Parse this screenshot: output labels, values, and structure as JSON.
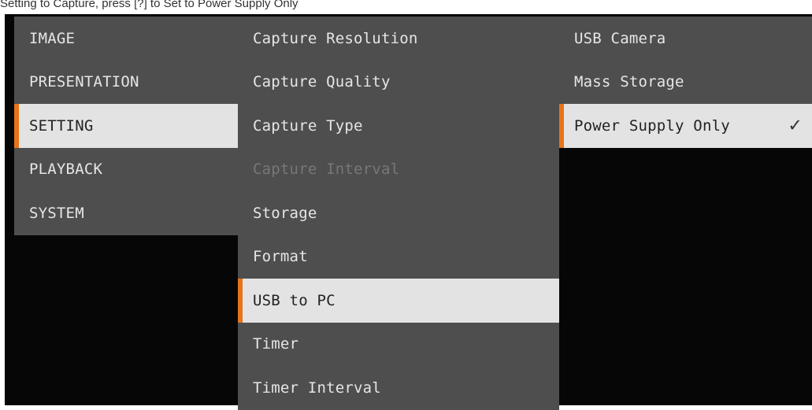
{
  "caption": "Setting to Capture, press [?] to Set to Power Supply Only",
  "main_menu": {
    "items": [
      {
        "label": "IMAGE",
        "selected": false
      },
      {
        "label": "PRESENTATION",
        "selected": false
      },
      {
        "label": "SETTING",
        "selected": true
      },
      {
        "label": "PLAYBACK",
        "selected": false
      },
      {
        "label": "SYSTEM",
        "selected": false
      }
    ]
  },
  "setting_menu": {
    "items": [
      {
        "label": "Capture Resolution",
        "selected": false,
        "enabled": true
      },
      {
        "label": "Capture Quality",
        "selected": false,
        "enabled": true
      },
      {
        "label": "Capture Type",
        "selected": false,
        "enabled": true
      },
      {
        "label": "Capture Interval",
        "selected": false,
        "enabled": false
      },
      {
        "label": "Storage",
        "selected": false,
        "enabled": true
      },
      {
        "label": "Format",
        "selected": false,
        "enabled": true
      },
      {
        "label": "USB to PC",
        "selected": true,
        "enabled": true
      },
      {
        "label": "Timer",
        "selected": false,
        "enabled": true
      },
      {
        "label": "Timer Interval",
        "selected": false,
        "enabled": true
      }
    ]
  },
  "usb_options": {
    "items": [
      {
        "label": "USB Camera",
        "selected": false,
        "checked": false
      },
      {
        "label": "Mass Storage",
        "selected": false,
        "checked": false
      },
      {
        "label": "Power Supply Only",
        "selected": true,
        "checked": true
      }
    ],
    "check_glyph": "✓"
  },
  "colors": {
    "accent": "#e8731a",
    "menu_bg": "#4e4e4e",
    "selected_bg": "#e3e3e3",
    "screen_bg": "#060606",
    "disabled_text": "#777777"
  }
}
